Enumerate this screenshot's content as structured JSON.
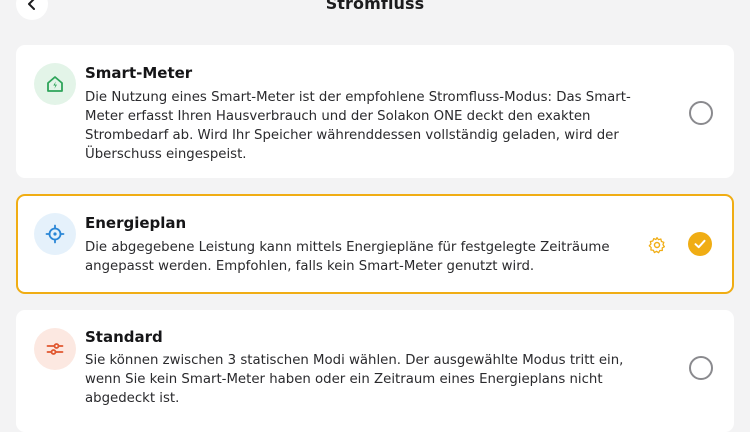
{
  "header": {
    "title": "Stromfluss",
    "back_icon": "chevron-left-icon"
  },
  "colors": {
    "accent": "#f0ad14",
    "background": "#f3f3f4",
    "card": "#ffffff",
    "smart_meter_icon": "#2ea45a",
    "energieplan_icon": "#2a86d6",
    "standard_icon": "#e0562e"
  },
  "modes": [
    {
      "icon": "home-energy-icon",
      "title": "Smart-Meter",
      "description_lines": [
        "Die Nutzung eines Smart-Meter ist der empfohlene Stromfluss-Modus: Das Smart-",
        "Meter erfasst Ihren Hausverbrauch und der Solakon ONE deckt den exakten",
        "Strombedarf ab. Wird Ihr Speicher währenddessen vollständig geladen, wird der",
        "Überschuss eingespeist."
      ],
      "selected": false
    },
    {
      "icon": "target-icon",
      "title": "Energieplan",
      "description_lines": [
        "Die abgegebene Leistung kann mittels Energiepläne für festgelegte Zeiträume",
        "angepasst werden. Empfohlen, falls kein Smart-Meter genutzt wird."
      ],
      "settings_icon": "gear-icon",
      "selected": true
    },
    {
      "icon": "sliders-icon",
      "title": "Standard",
      "description_lines": [
        "Sie können zwischen 3 statischen Modi wählen. Der ausgewählte Modus tritt ein,",
        "wenn Sie kein Smart-Meter haben oder ein Zeitraum eines Energieplans nicht",
        "abgedeckt ist."
      ],
      "selected": false
    }
  ]
}
